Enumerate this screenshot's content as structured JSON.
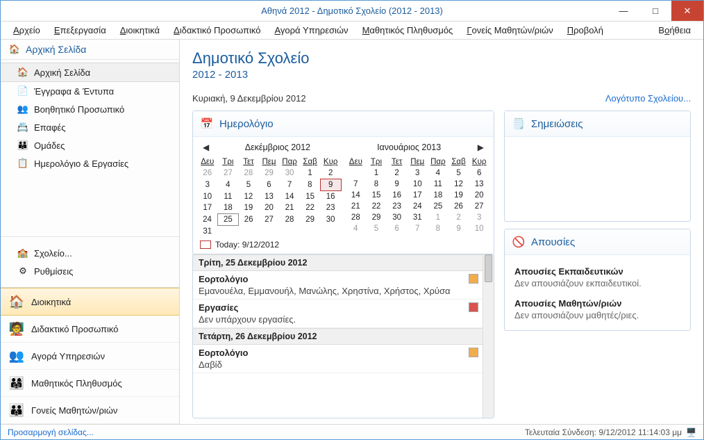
{
  "window": {
    "title": "Αθηνά 2012 - Δημοτικό Σχολείο (2012 - 2013)"
  },
  "menu": {
    "items": [
      "Αρχείο",
      "Επεξεργασία",
      "Διοικητικά",
      "Διδακτικό Προσωπικό",
      "Αγορά Υπηρεσιών",
      "Μαθητικός Πληθυσμός",
      "Γονείς Μαθητών/ριών",
      "Προβολή"
    ],
    "help": "Βοήθεια"
  },
  "sidebar": {
    "heading": "Αρχική Σελίδα",
    "items": [
      {
        "label": "Αρχική Σελίδα",
        "icon": "🏠",
        "selected": true
      },
      {
        "label": "Έγγραφα  &  Έντυπα",
        "icon": "📄",
        "selected": false
      },
      {
        "label": "Βοηθητικό Προσωπικό",
        "icon": "👥",
        "selected": false
      },
      {
        "label": "Επαφές",
        "icon": "📇",
        "selected": false
      },
      {
        "label": "Ομάδες",
        "icon": "👪",
        "selected": false
      },
      {
        "label": "Ημερολόγιο  &  Εργασίες",
        "icon": "📋",
        "selected": false
      }
    ],
    "lower": [
      {
        "label": "Σχολείο...",
        "icon": "🏫"
      },
      {
        "label": "Ρυθμίσεις",
        "icon": "⚙"
      }
    ],
    "bottom_nav": [
      {
        "label": "Διοικητικά",
        "icon": "🏠",
        "active": true
      },
      {
        "label": "Διδακτικό Προσωπικό",
        "icon": "🧑‍🏫",
        "active": false
      },
      {
        "label": "Αγορά Υπηρεσιών",
        "icon": "👥",
        "active": false
      },
      {
        "label": "Μαθητικός Πληθυσμός",
        "icon": "👨‍👩‍👧",
        "active": false
      },
      {
        "label": "Γονείς Μαθητών/ριών",
        "icon": "👪",
        "active": false
      }
    ]
  },
  "main": {
    "title": "Δημοτικό Σχολείο",
    "year": "2012 - 2013",
    "date": "Κυριακή, 9 Δεκεμβρίου 2012",
    "school_logo_link": "Λογότυπο Σχολείου..."
  },
  "calendar": {
    "title": "Ημερολόγιο",
    "today_label": "Today: 9/12/2012",
    "weekdays": [
      "Δευ",
      "Τρι",
      "Τετ",
      "Πεμ",
      "Παρ",
      "Σαβ",
      "Κυρ"
    ],
    "months": [
      {
        "title": "Δεκέμβριος 2012",
        "weeks": [
          [
            {
              "n": 26,
              "dim": true
            },
            {
              "n": 27,
              "dim": true
            },
            {
              "n": 28,
              "dim": true
            },
            {
              "n": 29,
              "dim": true
            },
            {
              "n": 30,
              "dim": true
            },
            {
              "n": 1
            },
            {
              "n": 2
            }
          ],
          [
            {
              "n": 3
            },
            {
              "n": 4
            },
            {
              "n": 5
            },
            {
              "n": 6
            },
            {
              "n": 7
            },
            {
              "n": 8
            },
            {
              "n": 9,
              "today": true
            }
          ],
          [
            {
              "n": 10
            },
            {
              "n": 11
            },
            {
              "n": 12
            },
            {
              "n": 13
            },
            {
              "n": 14
            },
            {
              "n": 15
            },
            {
              "n": 16
            }
          ],
          [
            {
              "n": 17
            },
            {
              "n": 18
            },
            {
              "n": 19
            },
            {
              "n": 20
            },
            {
              "n": 21
            },
            {
              "n": 22
            },
            {
              "n": 23
            }
          ],
          [
            {
              "n": 24
            },
            {
              "n": 25,
              "selected": true
            },
            {
              "n": 26
            },
            {
              "n": 27
            },
            {
              "n": 28
            },
            {
              "n": 29
            },
            {
              "n": 30
            }
          ],
          [
            {
              "n": 31
            },
            {
              "n": "",
              "dim": true
            },
            {
              "n": "",
              "dim": true
            },
            {
              "n": "",
              "dim": true
            },
            {
              "n": "",
              "dim": true
            },
            {
              "n": "",
              "dim": true
            },
            {
              "n": "",
              "dim": true
            }
          ]
        ]
      },
      {
        "title": "Ιανουάριος 2013",
        "weeks": [
          [
            {
              "n": "",
              "dim": true
            },
            {
              "n": 1
            },
            {
              "n": 2
            },
            {
              "n": 3
            },
            {
              "n": 4
            },
            {
              "n": 5
            },
            {
              "n": 6
            }
          ],
          [
            {
              "n": 7
            },
            {
              "n": 8
            },
            {
              "n": 9
            },
            {
              "n": 10
            },
            {
              "n": 11
            },
            {
              "n": 12
            },
            {
              "n": 13
            }
          ],
          [
            {
              "n": 14
            },
            {
              "n": 15
            },
            {
              "n": 16
            },
            {
              "n": 17
            },
            {
              "n": 18
            },
            {
              "n": 19
            },
            {
              "n": 20
            }
          ],
          [
            {
              "n": 21
            },
            {
              "n": 22
            },
            {
              "n": 23
            },
            {
              "n": 24
            },
            {
              "n": 25
            },
            {
              "n": 26
            },
            {
              "n": 27
            }
          ],
          [
            {
              "n": 28
            },
            {
              "n": 29
            },
            {
              "n": 30
            },
            {
              "n": 31
            },
            {
              "n": 1,
              "dim": true
            },
            {
              "n": 2,
              "dim": true
            },
            {
              "n": 3,
              "dim": true
            }
          ],
          [
            {
              "n": 4,
              "dim": true
            },
            {
              "n": 5,
              "dim": true
            },
            {
              "n": 6,
              "dim": true
            },
            {
              "n": 7,
              "dim": true
            },
            {
              "n": 8,
              "dim": true
            },
            {
              "n": 9,
              "dim": true
            },
            {
              "n": 10,
              "dim": true
            }
          ]
        ]
      }
    ]
  },
  "agenda": {
    "days": [
      {
        "header": "Τρίτη, 25 Δεκεμβρίου 2012",
        "sections": [
          {
            "title": "Εορτολόγιο",
            "body": "Εμανουέλα, Εμμανουήλ, Μανώλης, Χρηστίνα, Χρήστος, Χρύσα",
            "icon": "cal"
          },
          {
            "title": "Εργασίες",
            "body": "Δεν υπάρχουν  εργασίες.",
            "icon": "task"
          }
        ]
      },
      {
        "header": "Τετάρτη, 26 Δεκεμβρίου 2012",
        "sections": [
          {
            "title": "Εορτολόγιο",
            "body": "Δαβίδ",
            "icon": "cal"
          }
        ]
      }
    ]
  },
  "notes": {
    "title": "Σημειώσεις"
  },
  "absences": {
    "title": "Απουσίες",
    "teachers_title": "Απουσίες Εκπαιδευτικών",
    "teachers_body": "Δεν απουσιάζουν εκπαιδευτικοί.",
    "students_title": "Απουσίες Μαθητών/ριών",
    "students_body": "Δεν απουσιάζουν μαθητές/ριες."
  },
  "status": {
    "customize": "Προσαρμογή σελίδας...",
    "last_login": "Τελευταία Σύνδεση: 9/12/2012 11:14:03 μμ"
  }
}
